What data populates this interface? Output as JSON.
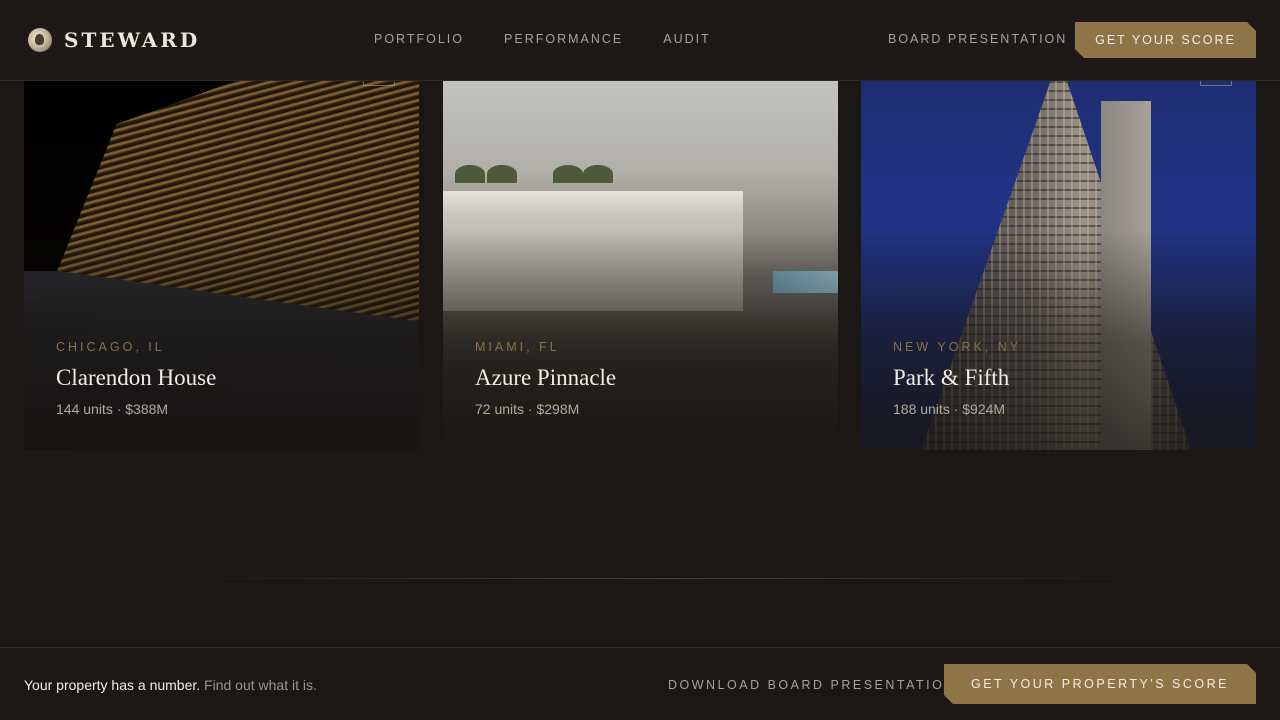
{
  "brand": {
    "name": "STEWARD"
  },
  "nav": {
    "items": [
      "PORTFOLIO",
      "PERFORMANCE",
      "AUDIT"
    ]
  },
  "header": {
    "board_link": "BOARD PRESENTATION",
    "cta": "GET YOUR SCORE"
  },
  "properties": [
    {
      "location": "CHICAGO, IL",
      "name": "Clarendon House",
      "meta": "144 units · $388M"
    },
    {
      "location": "MIAMI, FL",
      "name": "Azure Pinnacle",
      "meta": "72 units · $298M"
    },
    {
      "location": "NEW YORK, NY",
      "name": "Park & Fifth",
      "meta": "188 units · $924M"
    }
  ],
  "footer": {
    "tagline_strong": "Your property has a number.",
    "tagline_soft": "Find out what it is.",
    "download_link": "DOWNLOAD BOARD PRESENTATION",
    "cta": "GET YOUR PROPERTY'S SCORE"
  },
  "colors": {
    "accent": "#8f7448",
    "background": "#1b1714",
    "location_label": "#8a7048"
  }
}
